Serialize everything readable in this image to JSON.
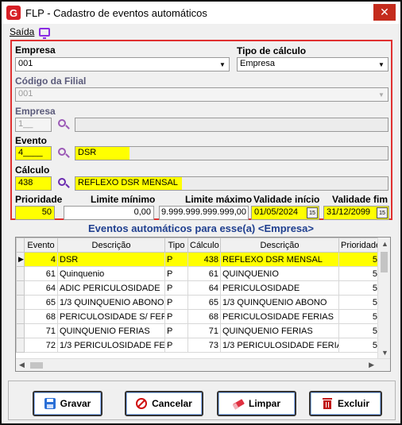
{
  "window": {
    "title": "FLP - Cadastro de eventos automáticos",
    "app_icon_letter": "G",
    "close_symbol": "✕"
  },
  "menu": {
    "saida": "Saída"
  },
  "form": {
    "empresa_label": "Empresa",
    "empresa_value": "001",
    "tipo_calculo_label": "Tipo de cálculo",
    "tipo_calculo_value": "Empresa",
    "codigo_filial_label": "Código da Filial",
    "codigo_filial_value": "001",
    "empresa2_label": "Empresa",
    "empresa2_code": "1__",
    "empresa2_name": "",
    "evento_label": "Evento",
    "evento_code": "4____",
    "evento_desc": "DSR",
    "calculo_label": "Cálculo",
    "calculo_code": "438",
    "calculo_desc": "REFLEXO DSR MENSAL",
    "prioridade_label": "Prioridade",
    "prioridade_value": "50",
    "limite_minimo_label": "Limite mínimo",
    "limite_minimo_value": "0,00",
    "limite_maximo_label": "Limite máximo",
    "limite_maximo_value": "9.999.999.999.999,00",
    "validade_inicio_label": "Validade início",
    "validade_inicio_value": "01/05/2024",
    "validade_fim_label": "Validade fim",
    "validade_fim_value": "31/12/2099"
  },
  "grid": {
    "title": "Eventos automáticos para esse(a) <Empresa>",
    "columns": [
      "Evento",
      "Descrição",
      "Tipo",
      "Cálculo",
      "Descrição",
      "Prioridade"
    ],
    "rows": [
      {
        "evento": "4",
        "descricao": "DSR",
        "tipo": "P",
        "calculo": "438",
        "calc_desc": "REFLEXO DSR MENSAL",
        "prioridade": "5"
      },
      {
        "evento": "61",
        "descricao": "Quinquenio",
        "tipo": "P",
        "calculo": "61",
        "calc_desc": "QUINQUENIO",
        "prioridade": "5"
      },
      {
        "evento": "64",
        "descricao": "ADIC PERICULOSIDADE",
        "tipo": "P",
        "calculo": "64",
        "calc_desc": "PERICULOSIDADE",
        "prioridade": "5"
      },
      {
        "evento": "65",
        "descricao": "1/3 QUINQUENIO ABONO",
        "tipo": "P",
        "calculo": "65",
        "calc_desc": "1/3 QUINQUENIO ABONO",
        "prioridade": "5"
      },
      {
        "evento": "68",
        "descricao": "PERICULOSIDADE S/ FER",
        "tipo": "P",
        "calculo": "68",
        "calc_desc": "PERICULOSIDADE FERIAS",
        "prioridade": "5"
      },
      {
        "evento": "71",
        "descricao": "QUINQUENIO FERIAS",
        "tipo": "P",
        "calculo": "71",
        "calc_desc": "QUINQUENIO FERIAS",
        "prioridade": "5"
      },
      {
        "evento": "72",
        "descricao": "1/3 PERICULOSIDADE FEF",
        "tipo": "P",
        "calculo": "73",
        "calc_desc": "1/3 PERICULOSIDADE FERIA",
        "prioridade": "5"
      }
    ]
  },
  "buttons": {
    "gravar": "Gravar",
    "cancelar": "Cancelar",
    "limpar": "Limpar",
    "excluir": "Excluir"
  }
}
